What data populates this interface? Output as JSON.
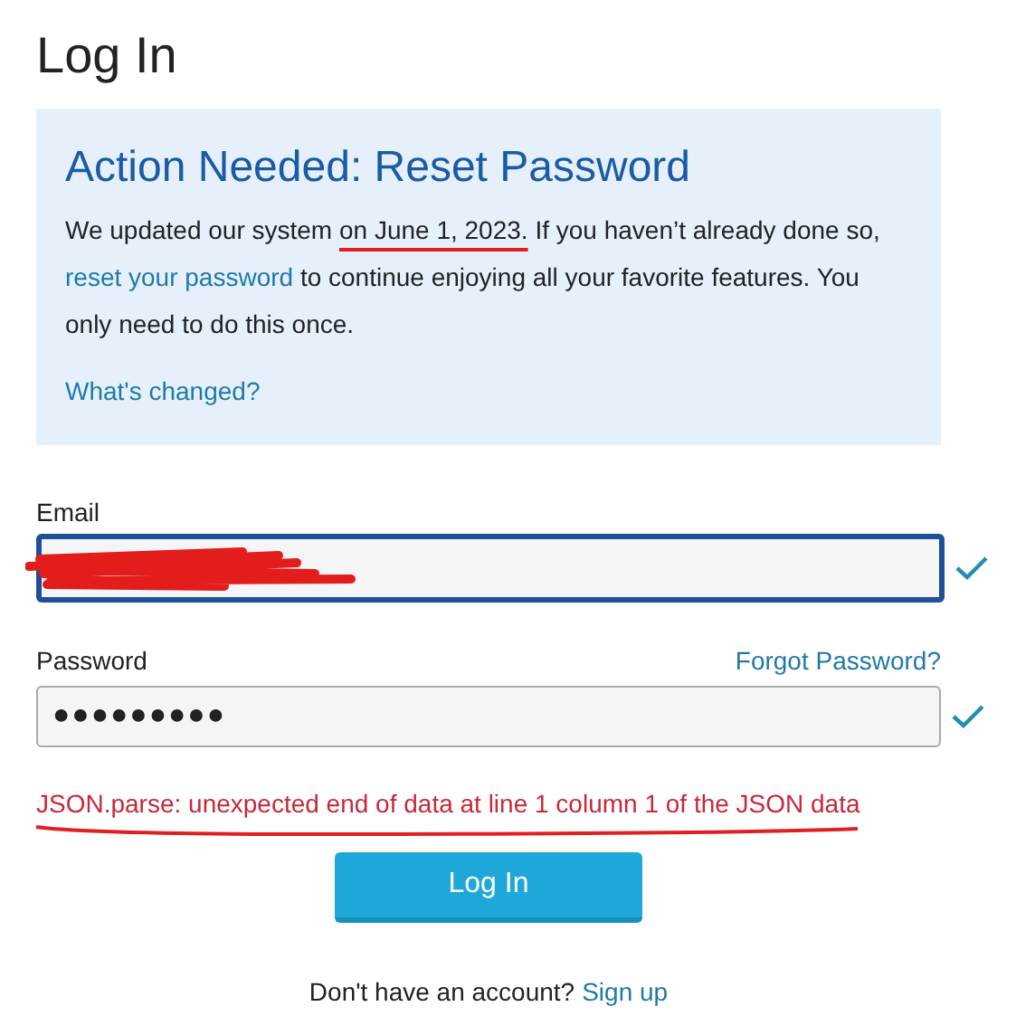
{
  "title": "Log In",
  "alert": {
    "heading": "Action Needed: Reset Password",
    "text_before": "We updated our system",
    "marked_text": "on June 1, 2023.",
    "text_middle": "If you haven’t already done so,",
    "link": "reset your password",
    "text_after": "to continue enjoying all your favorite features. You only need to do this once.",
    "more_link": "What's changed?"
  },
  "email": {
    "label": "Email",
    "focused": true,
    "valid": true,
    "redacted": true
  },
  "password": {
    "label": "Password",
    "forgot_link": "Forgot Password?",
    "value": "●●●●●●●●●",
    "valid": true
  },
  "error": {
    "text": "JSON.parse: unexpected end of data at line 1 column 1 of the JSON data",
    "underlined": true
  },
  "login_button": "Log In",
  "signup": {
    "text": "Don't have an account?",
    "link": "Sign up"
  }
}
